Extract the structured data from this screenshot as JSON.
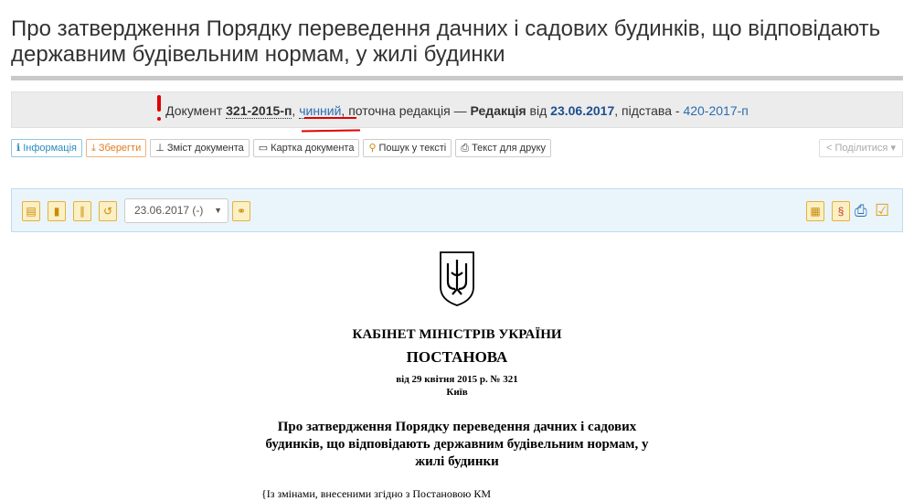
{
  "page": {
    "title": "Про затвердження Порядку переведення дачних і садових будинків, що відповідають державним будівельним нормам, у жилі будинки"
  },
  "status": {
    "prefix": "Документ",
    "doc_number": "321-2015-п",
    "comma1": ",",
    "status_word": "чинний",
    "current": ", поточна редакція —",
    "edition_label": "Редакція",
    "from": "від",
    "edition_date": "23.06.2017",
    "basis": ", підстава -",
    "basis_doc": "420-2017-п"
  },
  "toolbar": {
    "info": "Інформація",
    "save": "Зберегти",
    "contents": "Зміст документа",
    "card": "Картка документа",
    "search": "Пошук у тексті",
    "print": "Текст для друку",
    "share": "Поділитися"
  },
  "doc_panel": {
    "date_value": "23.06.2017 (-)"
  },
  "document": {
    "org": "КАБІНЕТ МІНІСТРІВ УКРАЇНИ",
    "type": "ПОСТАНОВА",
    "date_line": "від 29 квітня 2015 р. № 321",
    "city": "Київ",
    "heading": "Про затвердження Порядку переведення дачних і садових будинків, що відповідають державним будівельним нормам, у жилі будинки",
    "note": "{Із змінами, внесеними згідно з Постановою КМ"
  },
  "colors": {
    "accent_link": "#2a6db0",
    "annotation_red": "#e00000",
    "panel_bg": "#eaf4fb"
  }
}
